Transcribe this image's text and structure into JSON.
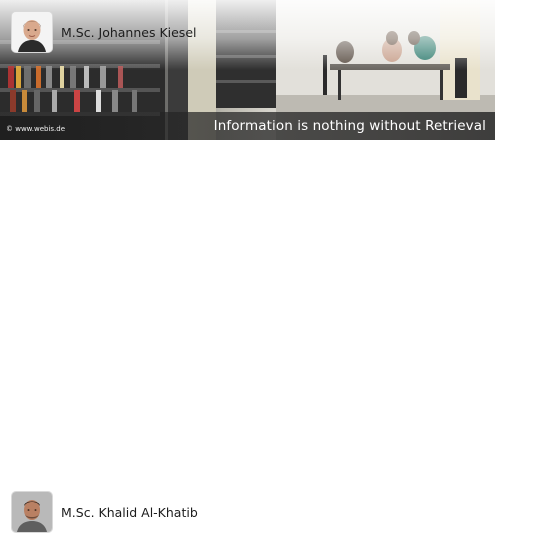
{
  "banner": {
    "copyright": "© www.webis.de",
    "tagline": "Information is nothing without Retrieval"
  },
  "people": [
    {
      "name": "M.Sc. Johannes Kiesel"
    },
    {
      "name": "M.Sc. Khalid Al-Khatib"
    }
  ],
  "icons": {
    "avatar_1": "person-photo-icon",
    "avatar_2": "person-photo-icon"
  }
}
